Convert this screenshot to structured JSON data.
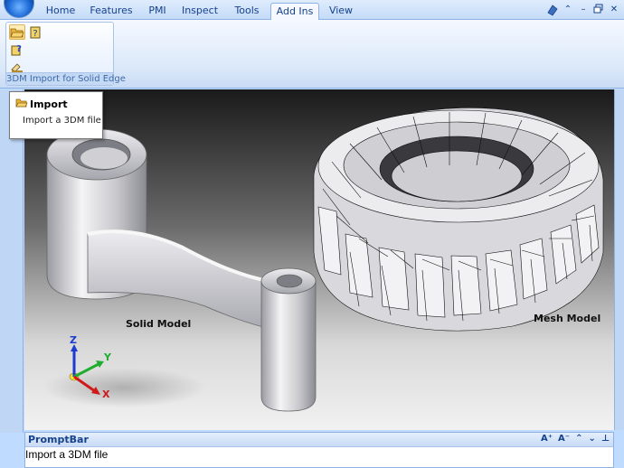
{
  "tabs": [
    {
      "label": "Home",
      "active": false
    },
    {
      "label": "Features",
      "active": false
    },
    {
      "label": "PMI",
      "active": false
    },
    {
      "label": "Inspect",
      "active": false
    },
    {
      "label": "Tools",
      "active": false
    },
    {
      "label": "Add Ins",
      "active": true
    },
    {
      "label": "View",
      "active": false
    }
  ],
  "ribbon": {
    "group_label": "3DM Import for Solid Edge",
    "buttons": [
      "open-folder-icon",
      "help-book-icon",
      "help-query-icon",
      "import-hand-icon"
    ]
  },
  "tooltip": {
    "title": "Import",
    "description": "Import a 3DM file"
  },
  "viewport": {
    "solid_label": "Solid Model",
    "mesh_label": "Mesh Model",
    "axes": {
      "z": "Z",
      "y": "Y",
      "x": "X"
    }
  },
  "promptbar": {
    "title": "PromptBar",
    "controls": [
      "A⁺",
      "A⁻",
      "⌃",
      "⌄",
      "⊥"
    ],
    "text": "Import a 3DM file"
  },
  "colors": {
    "ribbon_blue": "#bfdbff",
    "axis_z": "#1a3ccf",
    "axis_y": "#1fae2f",
    "axis_x": "#d01a1a"
  }
}
